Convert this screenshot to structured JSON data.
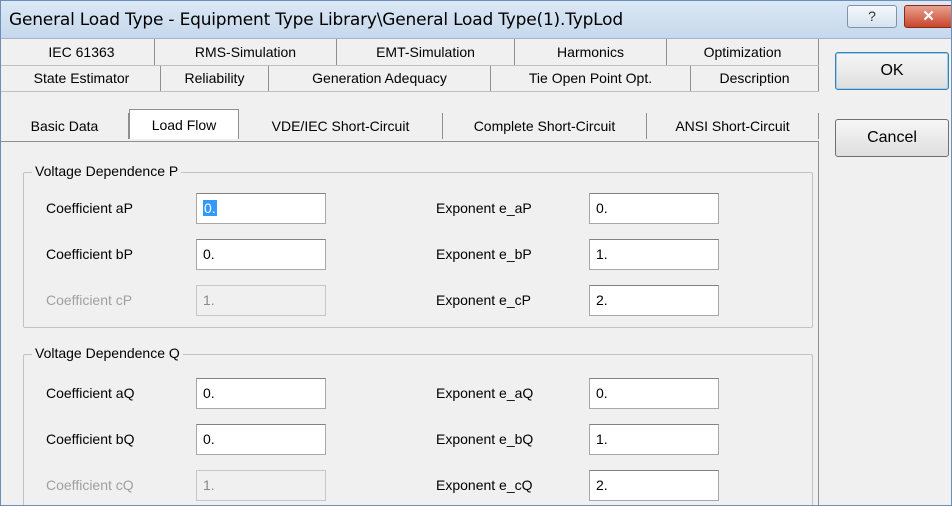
{
  "window": {
    "title": "General Load Type - Equipment Type Library\\General Load Type(1).TypLod",
    "help_glyph": "?",
    "close_glyph": "✕"
  },
  "tabs": {
    "row1": [
      "IEC 61363",
      "RMS-Simulation",
      "EMT-Simulation",
      "Harmonics",
      "Optimization"
    ],
    "row2": [
      "State Estimator",
      "Reliability",
      "Generation Adequacy",
      "Tie Open Point Opt.",
      "Description"
    ],
    "row3": [
      "Basic Data",
      "Load Flow",
      "VDE/IEC Short-Circuit",
      "Complete Short-Circuit",
      "ANSI Short-Circuit"
    ],
    "active": "Load Flow"
  },
  "buttons": {
    "ok": "OK",
    "cancel": "Cancel"
  },
  "groupP": {
    "title": "Voltage Dependence P",
    "coef_a_label": "Coefficient aP",
    "coef_a_value": "0.",
    "coef_b_label": "Coefficient bP",
    "coef_b_value": "0.",
    "coef_c_label": "Coefficient cP",
    "coef_c_value": "1.",
    "exp_a_label": "Exponent e_aP",
    "exp_a_value": "0.",
    "exp_b_label": "Exponent e_bP",
    "exp_b_value": "1.",
    "exp_c_label": "Exponent e_cP",
    "exp_c_value": "2."
  },
  "groupQ": {
    "title": "Voltage Dependence Q",
    "coef_a_label": "Coefficient aQ",
    "coef_a_value": "0.",
    "coef_b_label": "Coefficient bQ",
    "coef_b_value": "0.",
    "coef_c_label": "Coefficient cQ",
    "coef_c_value": "1.",
    "exp_a_label": "Exponent e_aQ",
    "exp_a_value": "0.",
    "exp_b_label": "Exponent e_bQ",
    "exp_b_value": "1.",
    "exp_c_label": "Exponent e_cQ",
    "exp_c_value": "2."
  }
}
